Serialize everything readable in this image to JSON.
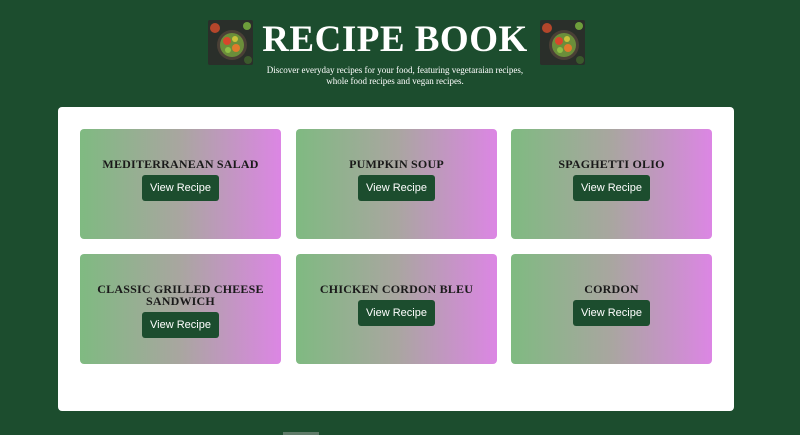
{
  "header": {
    "title": "RECIPE BOOK",
    "subtitle": "Discover everyday recipes for your food, featuring vegetaraian recipes, whole food recipes and vegan recipes.",
    "left_image": "food-bowl-image",
    "right_image": "food-bowl-image"
  },
  "colors": {
    "background": "#1c4d2e",
    "panel": "#ffffff",
    "button": "#1c4d2e",
    "card_gradient_start": "#7fba81",
    "card_gradient_end": "#dc86e4"
  },
  "recipes": [
    {
      "title": "MEDITERRANEAN SALAD",
      "button": "View Recipe"
    },
    {
      "title": "PUMPKIN SOUP",
      "button": "View Recipe"
    },
    {
      "title": "SPAGHETTI OLIO",
      "button": "View Recipe"
    },
    {
      "title": "CLASSIC GRILLED CHEESE SANDWICH",
      "button": "View Recipe"
    },
    {
      "title": "CHICKEN CORDON BLEU",
      "button": "View Recipe"
    },
    {
      "title": "CORDON",
      "button": "View Recipe"
    }
  ]
}
